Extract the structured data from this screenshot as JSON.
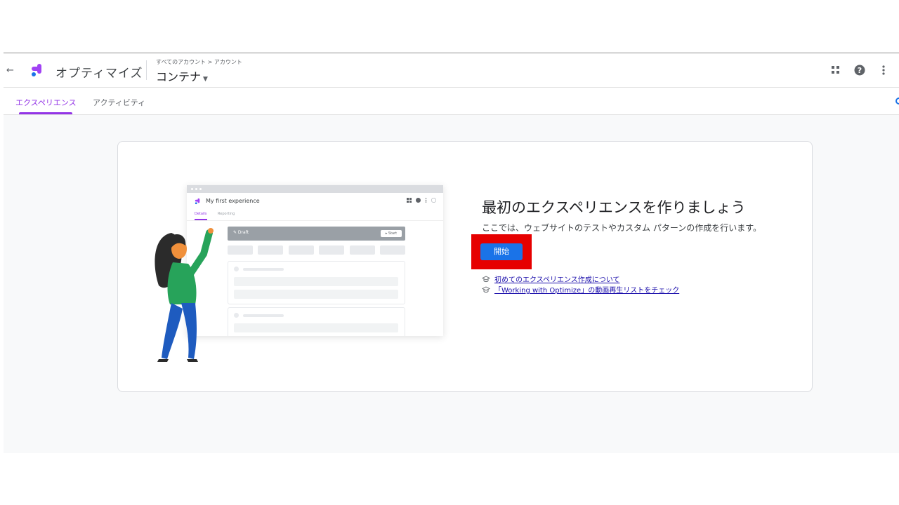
{
  "header": {
    "back_label": "←",
    "product_name": "オプティマイズ",
    "breadcrumb": "すべてのアカウント > アカウント",
    "container_name": "コンテナ",
    "icons": [
      "apps-grid-icon",
      "help-icon",
      "more-vert-icon"
    ]
  },
  "tabs": [
    {
      "label": "エクスペリエンス",
      "active": true
    },
    {
      "label": "アクティビティ",
      "active": false
    }
  ],
  "illustration": {
    "window_title": "My first experience",
    "tab_details": "Details",
    "tab_reporting": "Reporting",
    "draft_label": "✎ Draft",
    "start_label": "▸ Start"
  },
  "main": {
    "headline": "最初のエクスペリエンスを作りましょう",
    "subtext": "ここでは、ウェブサイトのテストやカスタム パターンの作成を行います。",
    "start_button": "開始",
    "links": [
      {
        "label": "初めてのエクスペリエンス作成について",
        "icon": "school-cap-icon"
      },
      {
        "label": "「Working with Optimize」の動画再生リストをチェック",
        "icon": "school-cap-icon"
      }
    ]
  },
  "colors": {
    "accent": "#9334e6",
    "primary_button": "#1a73e8",
    "highlight_box": "#e60000",
    "link": "#1a0dab"
  }
}
